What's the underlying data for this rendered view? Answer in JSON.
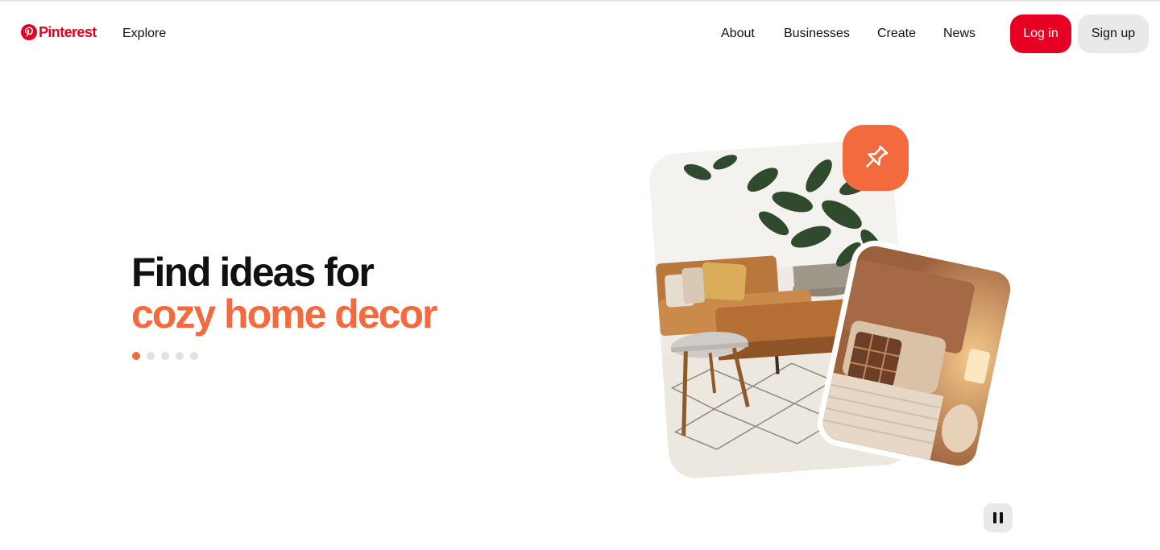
{
  "header": {
    "brand": "Pinterest",
    "explore_label": "Explore",
    "nav": {
      "about": "About",
      "businesses": "Businesses",
      "create": "Create",
      "news": "News"
    },
    "login_label": "Log in",
    "signup_label": "Sign up"
  },
  "hero": {
    "line1": "Find ideas for",
    "line2": "cozy home decor",
    "carousel_total": 5,
    "carousel_active": 1
  },
  "icons": {
    "logo": "pinterest-p-icon",
    "pin": "pushpin-icon",
    "pause": "pause-icon"
  },
  "colors": {
    "brand_red": "#e60023",
    "accent_orange": "#f26a3d",
    "secondary_button": "#e9e9e9"
  }
}
